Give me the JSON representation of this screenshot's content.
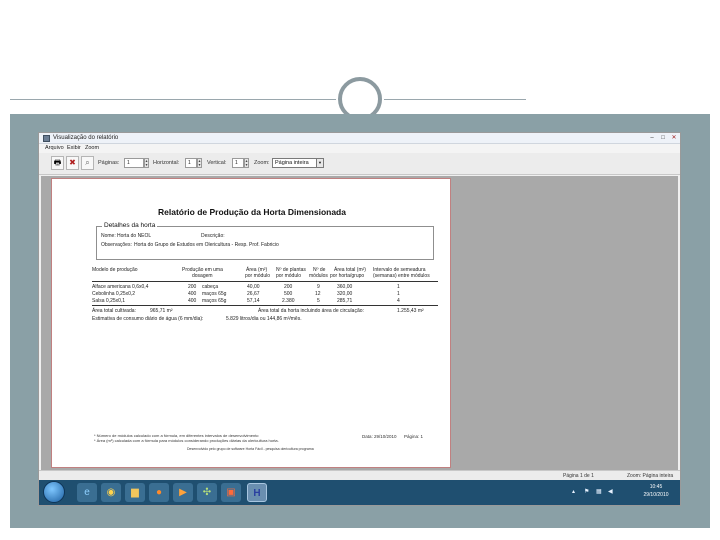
{
  "window": {
    "title": "Visualização do relatório",
    "controls": [
      "–",
      "□",
      "✕"
    ]
  },
  "menu": [
    "Arquivo",
    "Exibir",
    "Zoom"
  ],
  "toolbar": {
    "pages_label": "Páginas:",
    "pages_value": "1",
    "horizontal_label": "Horizontal:",
    "horizontal_value": "1",
    "vertical_label": "Vertical:",
    "vertical_value": "1",
    "zoom_label": "Zoom:",
    "zoom_value": "Página inteira"
  },
  "report": {
    "title": "Relatório de Produção da Horta Dimensionada",
    "group_title": "Detalhes da horta",
    "name_label": "Nome:",
    "name_value": "Horta do NEOL",
    "description_label": "Descrição:",
    "description_value": "",
    "notes_label": "Observações:",
    "notes_value": "Horta do Grupo de Estudos em Olericultura - Resp. Prof. Fabricio",
    "columns": [
      "Modelo de produção",
      "Produção em uma",
      "dosagem",
      "Área (m²)",
      "por módulo",
      "Nº de plantas",
      "por módulo",
      "Nº de",
      "módulos",
      "Área total (m²)",
      "por horta/grupo",
      "Intervalo de semeadura",
      "(semanas) entre módulos"
    ],
    "rows": [
      {
        "model": "Alface americana 0,6x0,4",
        "qty": "200",
        "unit": "cabeça",
        "area": "40,00",
        "plants": "200",
        "modules": "9",
        "total": "360,00",
        "interval": "1"
      },
      {
        "model": "Cebolinha 0,25x0,2",
        "qty": "400",
        "unit": "maços 65g",
        "area": "26,67",
        "plants": "500",
        "modules": "12",
        "total": "320,00",
        "interval": "1"
      },
      {
        "model": "Salsa 0,25x0,1",
        "qty": "400",
        "unit": "maços 65g",
        "area": "57,14",
        "plants": "2.380",
        "modules": "5",
        "total": "285,71",
        "interval": "4"
      }
    ],
    "total_area_label": "Área total cultivada:",
    "total_area_value": "965,71 m²",
    "total_with_circ_label": "Área total da horta incluindo área de circulação:",
    "total_with_circ_value": "1.255,43 m²",
    "consumption_label": "Estimativa de consumo diário de água (6 mm/dia):",
    "consumption_value": "5.829 litros/dia  ou  144,86 m³/mês.",
    "footnote_1": "* Número de módulos calculado com a fórmula, em diferentes intervalos de desenvolvimento",
    "footnote_2": "* Área (m²) calculada com a fórmula para módulos considerando produções diárias da olericultura horta.",
    "footnote_3": "Desenvolvido pelo grupo de software Horta Fácil - pesquisa olericultura programa",
    "date_label": "Data: 29/10/2010",
    "page_label": "Página: 1"
  },
  "status": {
    "page": "Página 1 de 1",
    "zoom": "Zoom: Página inteira"
  },
  "taskbar": {
    "time": "10:45",
    "date": "29/10/2010",
    "apps": [
      "explorer",
      "chrome",
      "folder",
      "firefox",
      "media-player",
      "tools",
      "presentation",
      "horta-app"
    ]
  },
  "colors": {
    "frame": "#8aa0a6",
    "taskbar": "#1f4f70",
    "content_bg": "#a9a9a9"
  }
}
